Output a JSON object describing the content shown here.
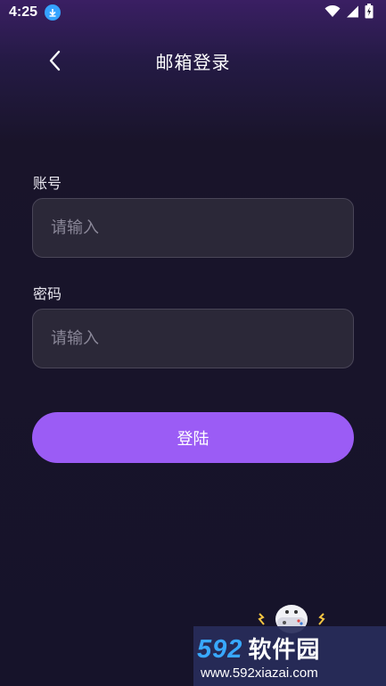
{
  "status_bar": {
    "time": "4:25",
    "icons": [
      "download-icon",
      "wifi-icon",
      "signal-icon",
      "battery-icon"
    ]
  },
  "header": {
    "title": "邮箱登录",
    "back_icon": "chevron-left-icon"
  },
  "form": {
    "account": {
      "label": "账号",
      "placeholder": "请输入",
      "value": ""
    },
    "password": {
      "label": "密码",
      "placeholder": "请输入",
      "value": ""
    },
    "submit_label": "登陆"
  },
  "watermark": {
    "brand_number": "592",
    "brand_text": "软件园",
    "url": "www.592xiazai.com"
  },
  "colors": {
    "background": "#16132a",
    "accent": "#9b5cf5",
    "input_bg": "#2b2838",
    "download_badge": "#35a3ff"
  }
}
